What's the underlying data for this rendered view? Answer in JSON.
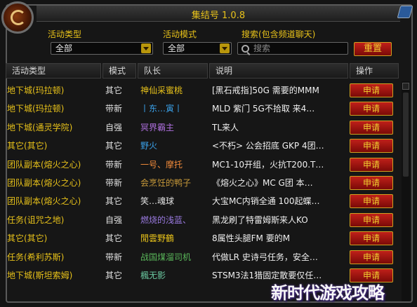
{
  "window": {
    "title": "集结号 1.0.8"
  },
  "filters": {
    "activity_type_label": "活动类型",
    "activity_type_value": "全部",
    "mode_label": "活动模式",
    "mode_value": "全部",
    "search_label": "搜索(包含频道聊天)",
    "search_placeholder": "搜索",
    "reset_label": "重置"
  },
  "table": {
    "headers": [
      "活动类型",
      "模式",
      "队长",
      "说明",
      "操作"
    ],
    "rows": [
      {
        "type": "地下城(玛拉顿)",
        "mode": "其它",
        "leader": "神仙采蜜桃",
        "leader_color": "#e8c21a",
        "note": "[黑石戒指]50G 需要的MMM",
        "action": "申请"
      },
      {
        "type": "地下城(玛拉顿)",
        "mode": "带新",
        "leader": "丨东…寅丨",
        "leader_color": "#3aa0e8",
        "note": "MLD 紫门 5G不拾取 来4…",
        "action": "申请"
      },
      {
        "type": "地下城(通灵学院)",
        "mode": "自强",
        "leader": "冥界霸主",
        "leader_color": "#b070e0",
        "note": "TL来人",
        "action": "申请"
      },
      {
        "type": "其它(其它)",
        "mode": "其它",
        "leader": "野火",
        "leader_color": "#3aa0e8",
        "note": "<不朽> 公会招底 GKP 4团…",
        "action": "申请"
      },
      {
        "type": "团队副本(熔火之心)",
        "mode": "带新",
        "leader": "一号、摩托",
        "leader_color": "#f08a3a",
        "note": "MC1-10开组，火抗T200.T…",
        "action": "申请"
      },
      {
        "type": "团队副本(熔火之心)",
        "mode": "带新",
        "leader": "会烹饪的鸭子",
        "leader_color": "#c89a3a",
        "note": "《熔火之心》MC G团 本…",
        "action": "申请"
      },
      {
        "type": "团队副本(熔火之心)",
        "mode": "其它",
        "leader": "笑…魂球",
        "leader_color": "#e0e0e0",
        "note": "大宝MC内销全通 100起蝶…",
        "action": "申请"
      },
      {
        "type": "任务(诅咒之地)",
        "mode": "自强",
        "leader": "燃烧的浅蓝、",
        "leader_color": "#9a7ae0",
        "note": "黑龙刷了特雷姆斯来人KO",
        "action": "申请"
      },
      {
        "type": "其它(其它)",
        "mode": "其它",
        "leader": "閒雲野鶴",
        "leader_color": "#e8c21a",
        "note": "8属性头腿FM 要的M",
        "action": "申请"
      },
      {
        "type": "任务(希利苏斯)",
        "mode": "带新",
        "leader": "战国煤溜司机",
        "leader_color": "#5ab85a",
        "note": "代做LR 史诗弓任务，安全…",
        "action": "申请"
      },
      {
        "type": "地下城(斯坦索姆)",
        "mode": "其它",
        "leader": "楓无影",
        "leader_color": "#6ac8a0",
        "note": "STSM3法1猎固定散要仅任…",
        "action": "申请"
      }
    ]
  },
  "watermark": "新时代游戏攻略"
}
